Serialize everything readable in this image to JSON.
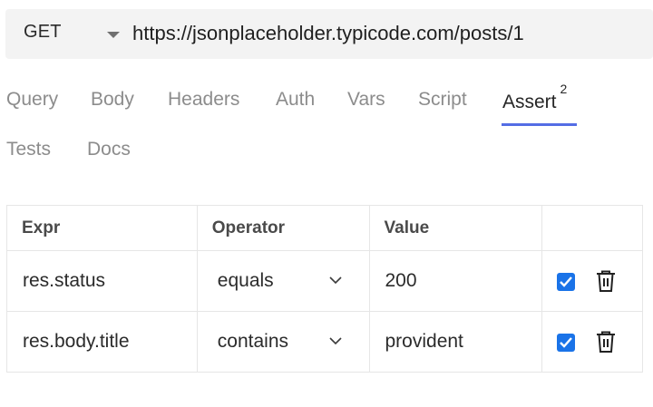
{
  "request": {
    "method": "GET",
    "url": "https://jsonplaceholder.typicode.com/posts/1"
  },
  "tabs": [
    {
      "label": "Query"
    },
    {
      "label": "Body"
    },
    {
      "label": "Headers"
    },
    {
      "label": "Auth"
    },
    {
      "label": "Vars"
    },
    {
      "label": "Script"
    },
    {
      "label": "Assert",
      "badge": "2",
      "active": true
    },
    {
      "label": "Tests"
    },
    {
      "label": "Docs"
    }
  ],
  "assertions": {
    "headers": {
      "expr": "Expr",
      "operator": "Operator",
      "value": "Value"
    },
    "rows": [
      {
        "expr": "res.status",
        "operator": "equals",
        "value": "200",
        "enabled": true
      },
      {
        "expr": "res.body.title",
        "operator": "contains",
        "value": "provident",
        "enabled": true
      }
    ]
  },
  "colors": {
    "accent": "#546de5",
    "checkbox": "#1a73e8"
  },
  "icons": {
    "method_dropdown": "caret-down-icon",
    "operator_dropdown": "chevron-down-icon",
    "delete": "trash-icon",
    "enabled": "checkbox-checked-icon"
  }
}
